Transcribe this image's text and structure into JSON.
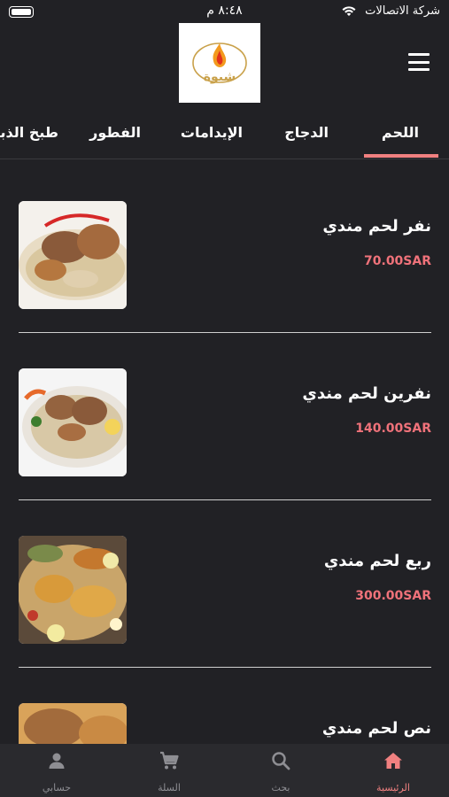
{
  "status_bar": {
    "carrier": "شركة الاتصالات",
    "time": "٨:٤٨ م"
  },
  "header": {
    "logo_icon": "flame-logo-icon",
    "logo_text": "شبوة"
  },
  "tabs": [
    {
      "label": "اللحم",
      "active": true
    },
    {
      "label": "الدجاج",
      "active": false
    },
    {
      "label": "الإيدامات",
      "active": false
    },
    {
      "label": "الفطور",
      "active": false
    },
    {
      "label": "طبخ الذبائح",
      "active": false
    }
  ],
  "items": [
    {
      "name": "نفر لحم مندي",
      "price": "70.00SAR"
    },
    {
      "name": "نفرين لحم مندي",
      "price": "140.00SAR"
    },
    {
      "name": "ربع لحم مندي",
      "price": "300.00SAR"
    },
    {
      "name": "نص لحم مندي",
      "price": ""
    }
  ],
  "bottom_nav": [
    {
      "label": "الرئيسية",
      "icon": "home-icon",
      "active": true
    },
    {
      "label": "بحث",
      "icon": "search-icon",
      "active": false
    },
    {
      "label": "السلة",
      "icon": "cart-icon",
      "active": false
    },
    {
      "label": "حسابي",
      "icon": "person-icon",
      "active": false
    }
  ],
  "colors": {
    "background": "#212125",
    "accent": "#f08080",
    "price": "#f0727a",
    "logo_gold": "#c9a14a"
  }
}
